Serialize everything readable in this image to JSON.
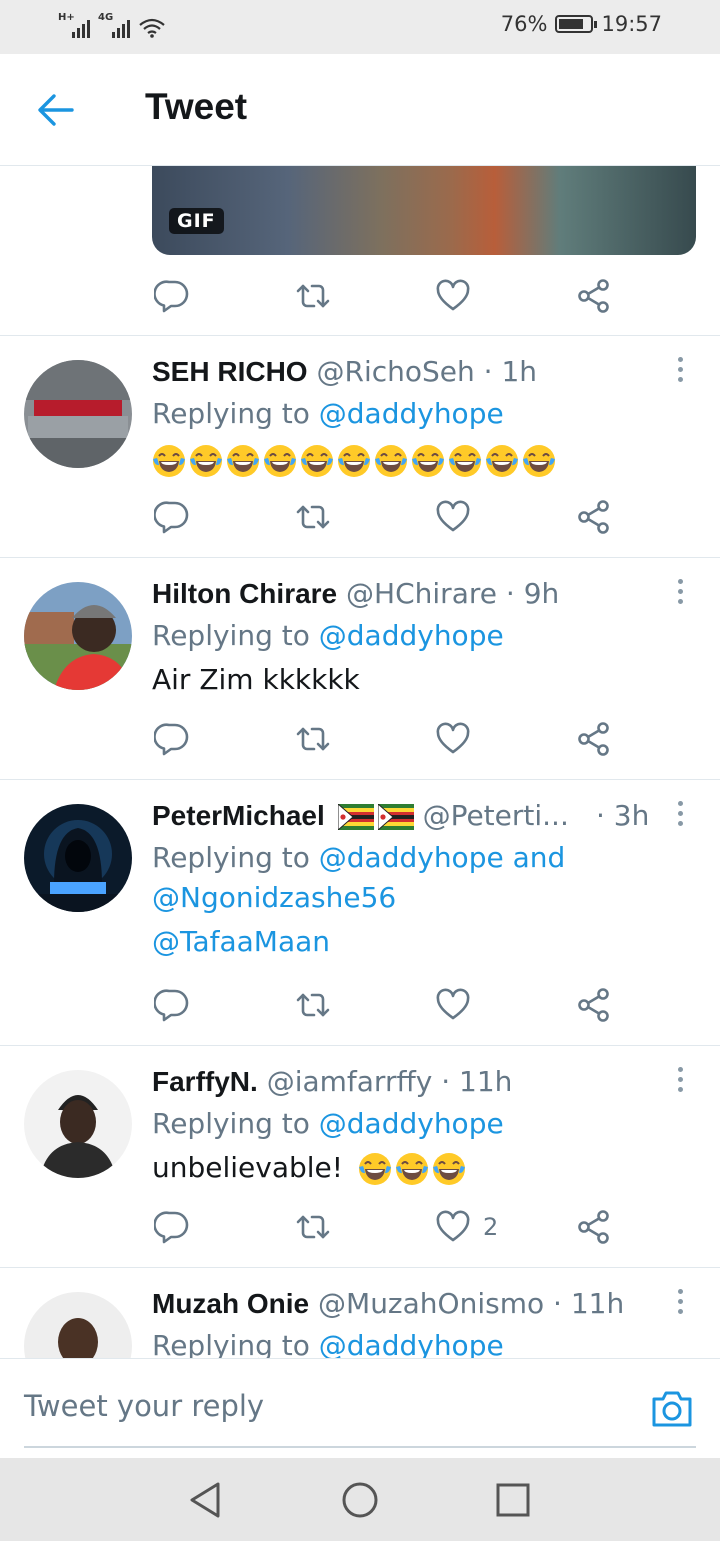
{
  "status": {
    "battery": "76%",
    "time": "19:57",
    "net1": "H+",
    "net2": "4G"
  },
  "appbar": {
    "title": "Tweet"
  },
  "gif": {
    "badge": "GIF"
  },
  "tweets": [
    {
      "name": "SEH RICHO",
      "handle": "@RichoSeh",
      "time": "· 1h",
      "replying_prefix": "Replying to ",
      "replying_to": "@daddyhope",
      "emoji_count": 11
    },
    {
      "name": "Hilton Chirare",
      "handle": "@HChirare",
      "time": "· 9h",
      "replying_prefix": "Replying to ",
      "replying_to": "@daddyhope",
      "text": "Air Zim kkkkkk"
    },
    {
      "name": "PeterMichael",
      "handle": "@Peterti...",
      "time": "· 3h",
      "replying_prefix": "Replying to ",
      "replying_to": "@daddyhope",
      "replying_and": " and",
      "replying_to2": "@Ngonidzashe56",
      "text": "@TafaaMaan",
      "flags": "zimbabwe-flag"
    },
    {
      "name": "FarffyN.",
      "handle": "@iamfarrffy",
      "time": "· 11h",
      "replying_prefix": "Replying to ",
      "replying_to": "@daddyhope",
      "text": "unbelievable!",
      "emoji_count": 3,
      "like_count": "2"
    },
    {
      "name": "Muzah Onie",
      "handle": "@MuzahOnismo",
      "time": "· 11h",
      "replying_prefix": "Replying to ",
      "replying_to": "@daddyhope"
    }
  ],
  "reply_bar": {
    "placeholder": "Tweet your reply"
  },
  "colors": {
    "accent": "#1b95e0",
    "secondary_text": "#657786",
    "divider": "#e1e8ed"
  },
  "icons": [
    "back-arrow-icon",
    "reply-icon",
    "retweet-icon",
    "like-icon",
    "share-icon",
    "more-icon",
    "camera-icon",
    "nav-back-icon",
    "nav-home-icon",
    "nav-recents-icon",
    "tears-of-joy-emoji"
  ]
}
